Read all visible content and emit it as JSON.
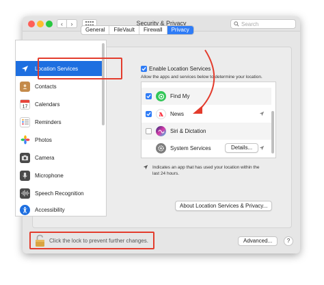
{
  "window": {
    "title": "Security & Privacy",
    "back_glyph": "‹",
    "forward_glyph": "›"
  },
  "search": {
    "placeholder": "Search"
  },
  "tabs": [
    {
      "label": "General"
    },
    {
      "label": "FileVault"
    },
    {
      "label": "Firewall"
    },
    {
      "label": "Privacy"
    }
  ],
  "sidebar": {
    "items": [
      {
        "label": "Location Services",
        "icon": "location-arrow-icon"
      },
      {
        "label": "Contacts",
        "icon": "contacts-book-icon"
      },
      {
        "label": "Calendars",
        "icon": "calendar-icon"
      },
      {
        "label": "Reminders",
        "icon": "reminders-list-icon"
      },
      {
        "label": "Photos",
        "icon": "photos-flower-icon"
      },
      {
        "label": "Camera",
        "icon": "camera-icon"
      },
      {
        "label": "Microphone",
        "icon": "microphone-icon"
      },
      {
        "label": "Speech Recognition",
        "icon": "waveform-icon"
      },
      {
        "label": "Accessibility",
        "icon": "accessibility-icon"
      }
    ]
  },
  "location": {
    "enable_label": "Enable Location Services",
    "description": "Allow the apps and services below to determine your location.",
    "apps": [
      {
        "name": "Find My",
        "checked": true
      },
      {
        "name": "News",
        "checked": true
      },
      {
        "name": "Siri & Dictation",
        "checked": false
      },
      {
        "name": "System Services",
        "details_label": "Details..."
      }
    ],
    "legend_line1": "Indicates an app that has used your location within the",
    "legend_line2": "last 24 hours.",
    "about_button": "About Location Services & Privacy..."
  },
  "footer": {
    "lock_text": "Click the lock to prevent further changes.",
    "advanced_button": "Advanced...",
    "help_button": "?"
  },
  "colors": {
    "accent": "#2f7cf6",
    "selection": "#1e6fe0",
    "highlight_annotation": "#e33b2c"
  }
}
